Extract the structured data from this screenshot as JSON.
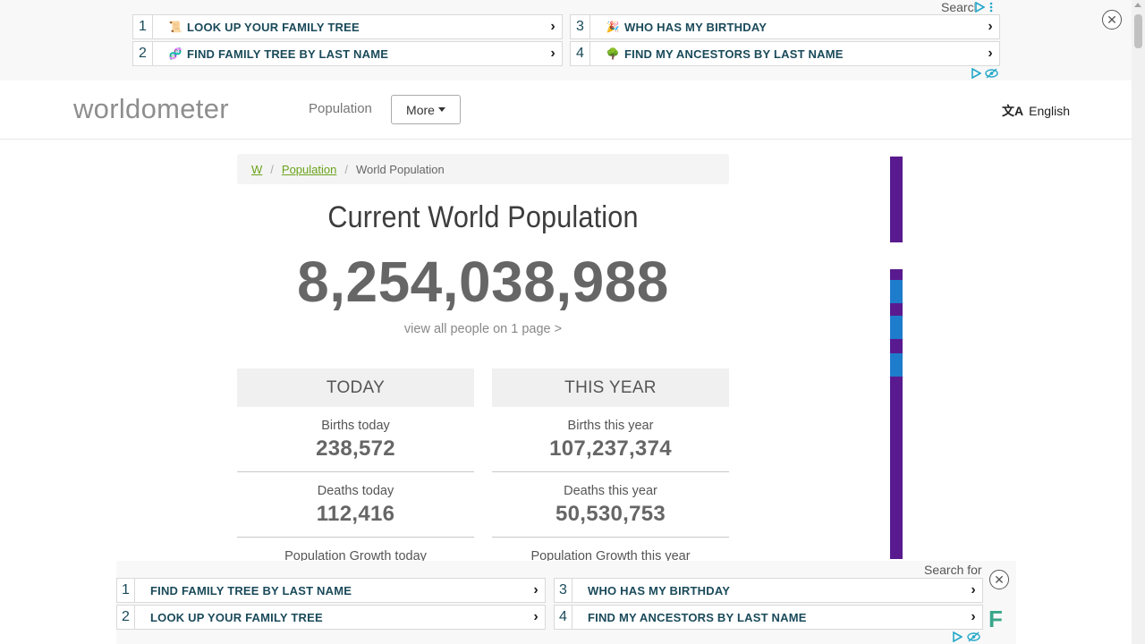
{
  "top_ad": {
    "search_label": "Search for",
    "items": [
      {
        "num": "1",
        "emoji": "📜",
        "label": "LOOK UP YOUR FAMILY TREE"
      },
      {
        "num": "2",
        "emoji": "🧬",
        "label": "FIND FAMILY TREE BY LAST NAME"
      },
      {
        "num": "3",
        "emoji": "🎉",
        "label": "WHO HAS MY BIRTHDAY"
      },
      {
        "num": "4",
        "emoji": "🌳",
        "label": "FIND MY ANCESTORS BY LAST NAME"
      }
    ],
    "close": "✕",
    "chevron": "›"
  },
  "nav": {
    "logo_a": "worldo",
    "logo_o": "m",
    "logo_b": "eter",
    "population": "Population",
    "more": "More",
    "lang_icon": "文A",
    "language": "English"
  },
  "breadcrumb": {
    "home": "W",
    "sep": "/",
    "population": "Population",
    "current": "World Population"
  },
  "main": {
    "title": "Current World Population",
    "counter": "8,254,038,988",
    "view_all": "view all people on 1 page >"
  },
  "today": {
    "heading": "TODAY",
    "stats": [
      {
        "label": "Births today",
        "value": "238,572"
      },
      {
        "label": "Deaths today",
        "value": "112,416"
      },
      {
        "label": "Population Growth today",
        "value": ""
      }
    ]
  },
  "this_year": {
    "heading": "THIS YEAR",
    "stats": [
      {
        "label": "Births this year",
        "value": "107,237,374"
      },
      {
        "label": "Deaths this year",
        "value": "50,530,753"
      },
      {
        "label": "Population Growth this year",
        "value": ""
      }
    ]
  },
  "bottom_ad": {
    "search_label": "Search for",
    "items": [
      {
        "num": "1",
        "label": "FIND FAMILY TREE BY LAST NAME"
      },
      {
        "num": "2",
        "label": "LOOK UP YOUR FAMILY TREE"
      },
      {
        "num": "3",
        "label": "WHO HAS MY BIRTHDAY"
      },
      {
        "num": "4",
        "label": "FIND MY ANCESTORS BY LAST NAME"
      }
    ],
    "close": "✕",
    "logo": "F",
    "chevron": "›"
  },
  "colors": {
    "brand_green": "#88c425",
    "link_green": "#6aa31c",
    "ad_purple": "#5a1a8f"
  }
}
